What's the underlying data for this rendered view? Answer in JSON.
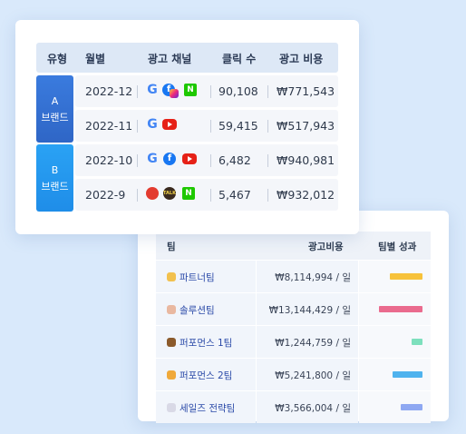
{
  "top_table": {
    "headers": [
      "유형",
      "월별",
      "광고 채널",
      "클릭 수",
      "광고 비용"
    ],
    "groups": [
      {
        "line1": "A",
        "line2": "브랜드",
        "color": "#3270d6"
      },
      {
        "line1": "B",
        "line2": "브랜드",
        "color": "#239aef"
      }
    ],
    "rows": [
      {
        "month": "2022-12",
        "channels": [
          "google-icon",
          "facebook-icon",
          "instagram-icon",
          "naver-icon"
        ],
        "clicks": "90,108",
        "cost": "₩771,543"
      },
      {
        "month": "2022-11",
        "channels": [
          "google-icon",
          "youtube-icon"
        ],
        "clicks": "59,415",
        "cost": "₩517,943"
      },
      {
        "month": "2022-10",
        "channels": [
          "google-icon",
          "facebook-icon",
          "youtube-icon"
        ],
        "clicks": "6,482",
        "cost": "₩940,981"
      },
      {
        "month": "2022-9",
        "channels": [
          "kakao-icon",
          "talk-icon",
          "naver-icon"
        ],
        "clicks": "5,467",
        "cost": "₩932,012"
      }
    ]
  },
  "bottom_table": {
    "headers": [
      "팀",
      "광고비용",
      "팀별 성과"
    ],
    "rows": [
      {
        "emoji": "cat-icon",
        "team": "파트너팀",
        "cost": "₩8,114,994 / 일",
        "perf": 0.6,
        "color": "#f7c23a"
      },
      {
        "emoji": "bear-face-icon",
        "team": "솔루션팀",
        "cost": "₩13,144,429 / 일",
        "perf": 0.8,
        "color": "#ea6b8e"
      },
      {
        "emoji": "bear-icon",
        "team": "퍼포먼스 1팀",
        "cost": "₩1,244,759 / 일",
        "perf": 0.2,
        "color": "#7de0bd"
      },
      {
        "emoji": "lion-icon",
        "team": "퍼포먼스 2팀",
        "cost": "₩5,241,800 / 일",
        "perf": 0.55,
        "color": "#4fb3ee"
      },
      {
        "emoji": "rabbit-icon",
        "team": "세일즈 전략팀",
        "cost": "₩3,566,004 / 일",
        "perf": 0.4,
        "color": "#8ea8f2"
      }
    ]
  }
}
